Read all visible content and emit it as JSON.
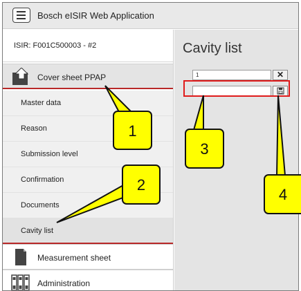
{
  "app": {
    "title": "Bosch  eISIR Web Application"
  },
  "sidebar": {
    "isir_label": "ISIR: F001C500003 - #2",
    "cover_sheet": {
      "label": "Cover sheet PPAP",
      "items": [
        {
          "label": "Master data"
        },
        {
          "label": "Reason"
        },
        {
          "label": "Submission level"
        },
        {
          "label": "Confirmation"
        },
        {
          "label": "Documents"
        },
        {
          "label": "Cavity list"
        }
      ]
    },
    "measurement_sheet": {
      "label": "Measurement sheet"
    },
    "administration": {
      "label": "Administration"
    }
  },
  "main": {
    "title": "Cavity list",
    "cavity_rows": [
      {
        "value": "1"
      }
    ],
    "new_cavity": {
      "value": ""
    },
    "delete_symbol": "✕"
  },
  "annotations": [
    "1",
    "2",
    "3",
    "4"
  ],
  "colors": {
    "highlight": "#e01a1a",
    "callout": "#ffff00",
    "active_border": "#b82828"
  }
}
